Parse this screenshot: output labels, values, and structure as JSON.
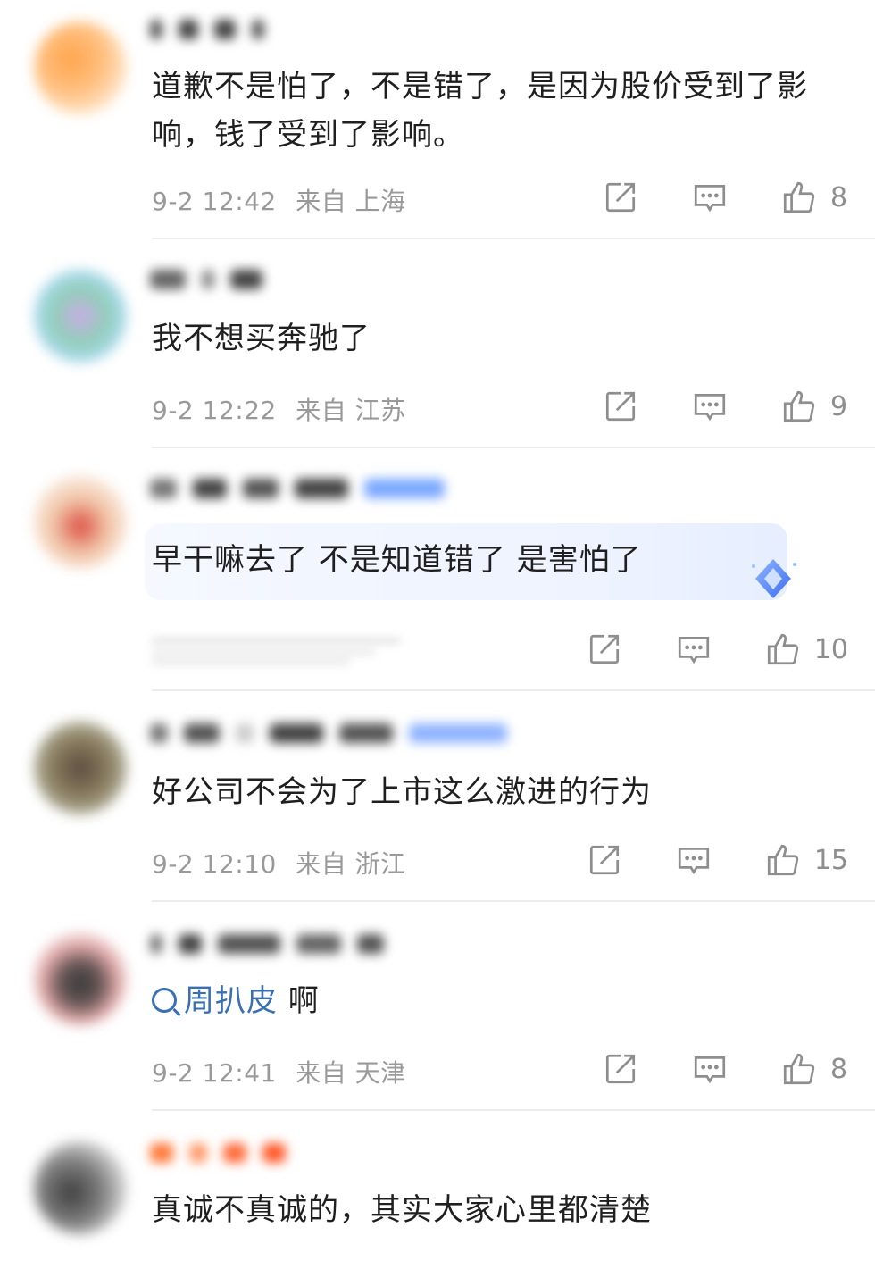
{
  "comments": [
    {
      "text": "道歉不是怕了，不是错了，是因为股价受到了影响，钱了受到了影响。",
      "text_line2": "",
      "time": "9-2 12:42",
      "source": "来自 上海",
      "likes": "8"
    },
    {
      "text": "我不想买奔驰了",
      "time": "9-2 12:22",
      "source": "来自 江苏",
      "likes": "9"
    },
    {
      "text": "早干嘛去了 不是知道错了 是害怕了",
      "likes": "10"
    },
    {
      "text": "好公司不会为了上市这么激进的行为",
      "time": "9-2 12:10",
      "source": "来自 浙江",
      "likes": "15"
    },
    {
      "topic": "周扒皮",
      "text": " 啊",
      "time": "9-2 12:41",
      "source": "来自 天津",
      "likes": "8"
    },
    {
      "text": "真诚不真诚的，其实大家心里都清楚"
    }
  ],
  "icons": {
    "share": "share-icon",
    "comment": "comment-icon",
    "like": "thumbs-up-icon",
    "search": "search-icon",
    "badge": "diamond-badge-icon"
  },
  "colors": {
    "meta_text": "#999999",
    "topic_link": "#3a6fb4",
    "divider": "#ececec"
  }
}
